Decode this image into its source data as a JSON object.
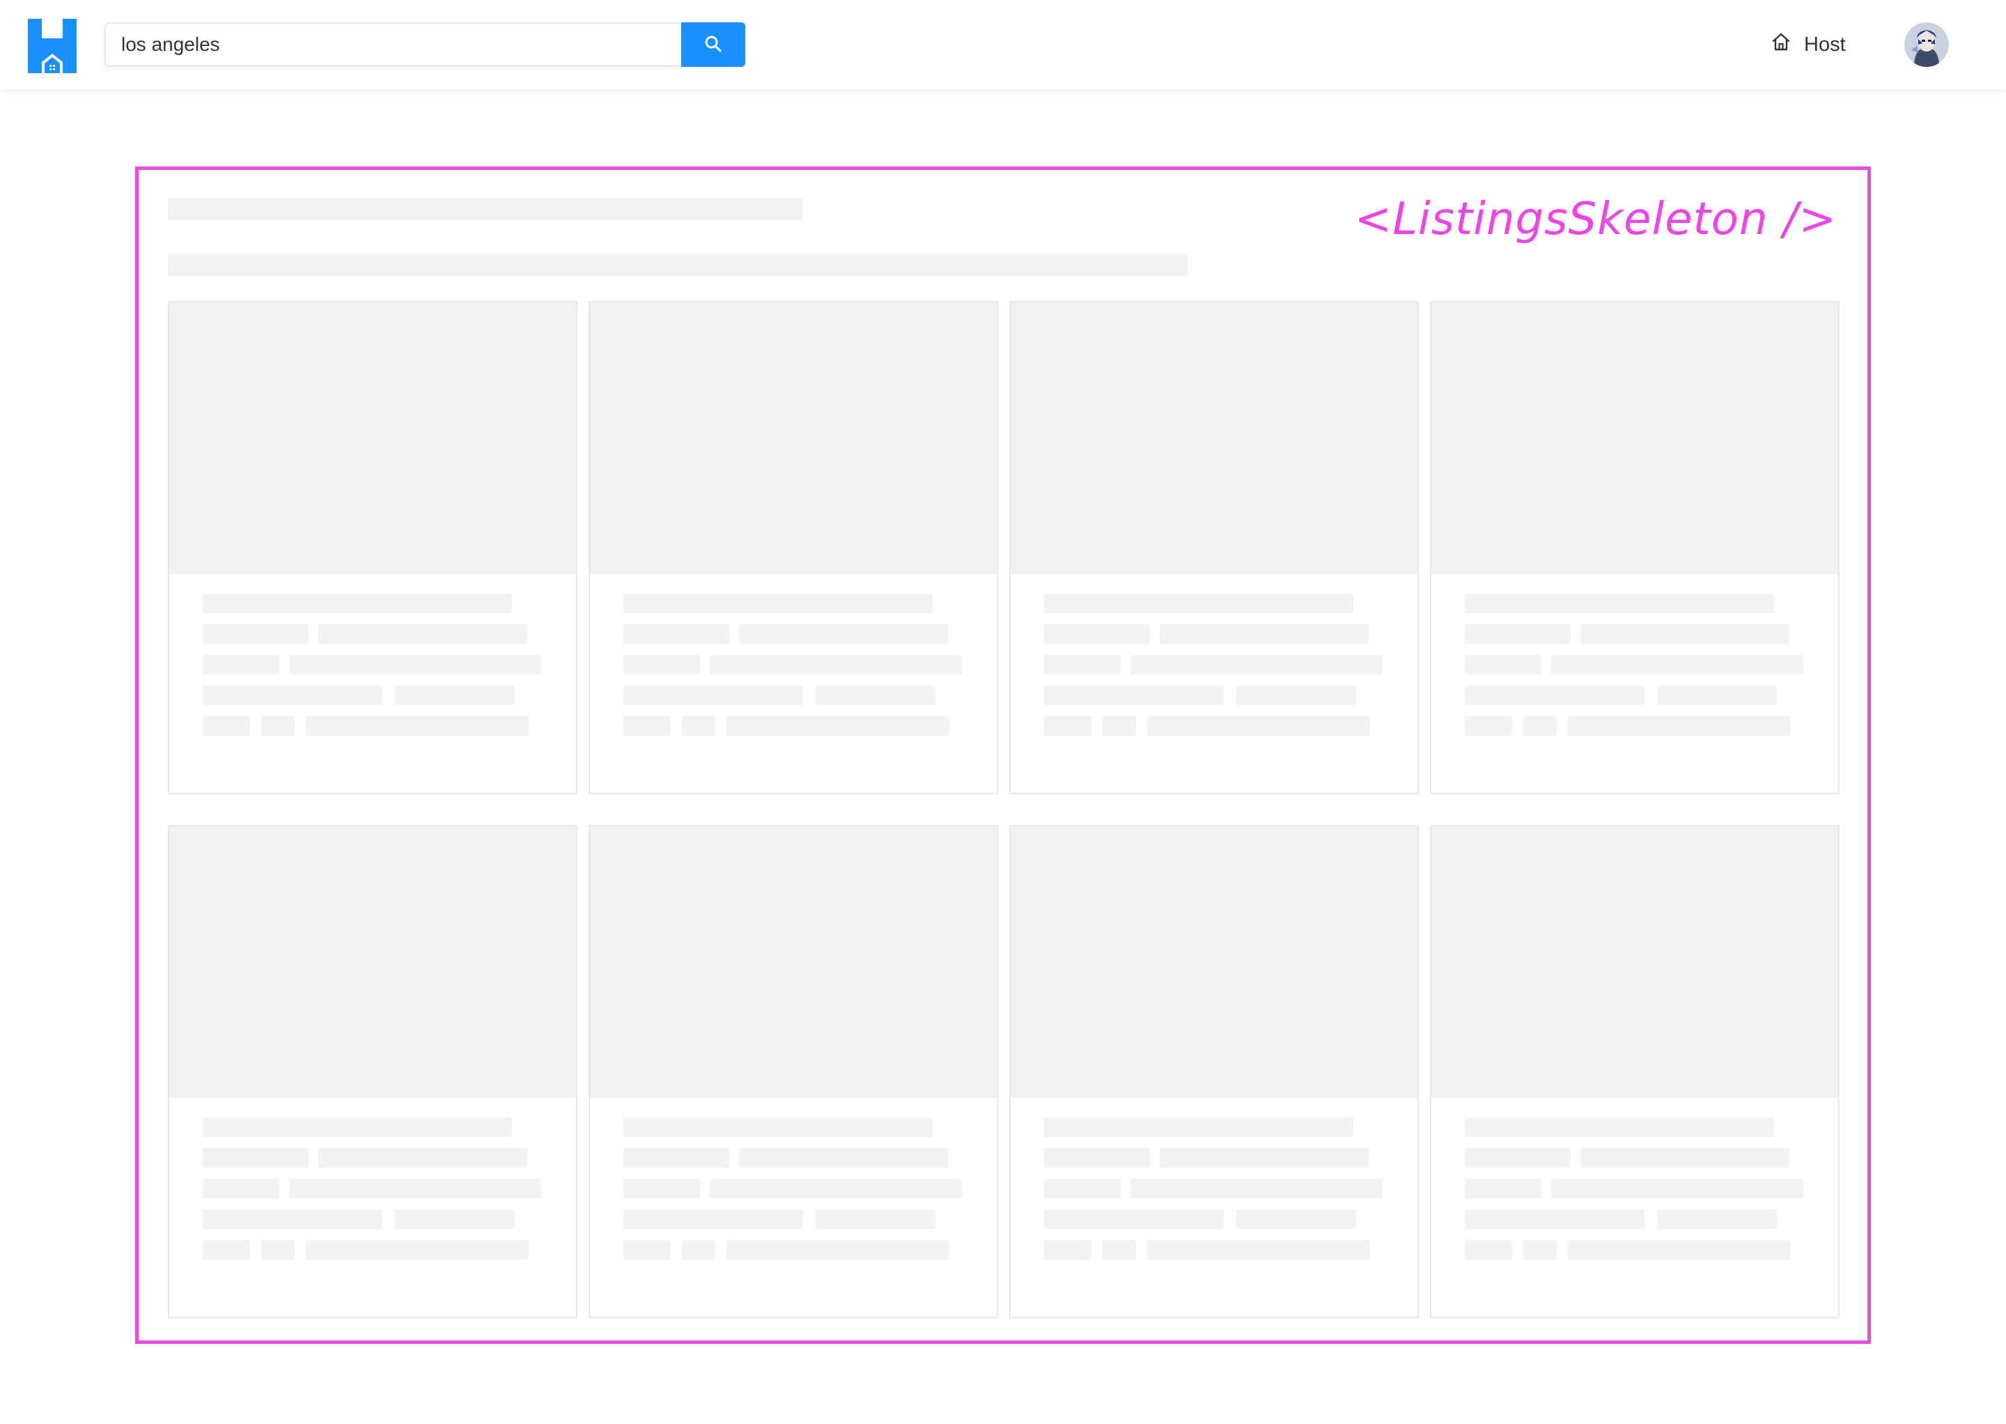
{
  "header": {
    "logo_icon": "house-logo-icon",
    "brand_color": "#1890ff",
    "search": {
      "value": "los angeles",
      "placeholder": "",
      "button_icon": "search-icon"
    },
    "host_link": {
      "label": "Host",
      "icon": "home-icon"
    },
    "avatar_icon": "user-avatar"
  },
  "skeleton": {
    "annotation_label": "<ListingsSkeleton />",
    "annotation_color": "#e84ee6",
    "placeholder_color": "#f2f2f2",
    "card_count": 8
  }
}
